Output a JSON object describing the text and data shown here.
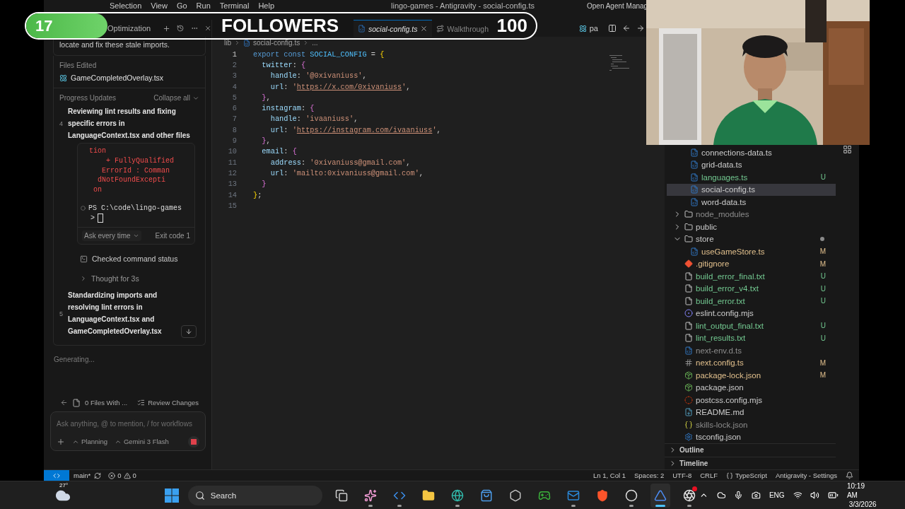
{
  "stream_banner": {
    "count": "17",
    "label": "FOLLOWERS",
    "goal": "100",
    "level": 0.16
  },
  "menu": [
    "Selection",
    "View",
    "Go",
    "Run",
    "Terminal",
    "Help"
  ],
  "window_title": "lingo-games - Antigravity - social-config.ts",
  "agent_manager_link": "Open Agent Manag",
  "agent": {
    "tab_title": "Optimization",
    "message_tail": "locate and fix these stale imports.",
    "files_edited": {
      "heading": "Files Edited",
      "files": [
        "GameCompletedOverlay.tsx"
      ]
    },
    "progress": {
      "heading": "Progress Updates",
      "collapse": "Collapse all",
      "steps": [
        {
          "number": "4",
          "title": "Reviewing lint results and fixing specific errors in LanguageContext.tsx and other files",
          "items": [
            {
              "kind": "terminal",
              "output": [
                "tion",
                "    + FullyQualified",
                "   ErrorId : Comman",
                "  dNotFoundExcepti",
                " on"
              ],
              "prompt": "PS C:\\code\\lingo-games",
              "continuation": ">",
              "approval": "Ask every time",
              "exit": "Exit code 1"
            },
            {
              "kind": "tool",
              "label": "Checked command status"
            },
            {
              "kind": "thought",
              "label": "Thought for 3s",
              "expanded": false
            }
          ]
        },
        {
          "number": "5",
          "title": "Standardizing imports and resolving lint errors in LanguageContext.tsx and GameCompletedOverlay.tsx"
        }
      ]
    },
    "status": "Generating...",
    "files_with": "0 Files With ...",
    "review": "Review Changes",
    "placeholder": "Ask anything, @ to mention, / for workflows",
    "mode": "Planning",
    "model": "Gemini 3 Flash"
  },
  "editor": {
    "tabs": [
      {
        "label": "social-config.ts",
        "kind": "ts",
        "selected": true,
        "preview": true
      },
      {
        "label": "Walkthrough",
        "kind": "steps",
        "selected": false,
        "preview": false
      }
    ],
    "side_tab": "pa",
    "breadcrumb": [
      "lib",
      "social-config.ts",
      "..."
    ],
    "lines": [
      {
        "number": "1",
        "active": true,
        "tokens": [
          {
            "t": "export const ",
            "kind": "keyword"
          },
          {
            "t": "SOCIAL_CONFIG",
            "kind": "constant"
          },
          {
            "t": " = ",
            "kind": "operator"
          },
          {
            "t": "{",
            "kind": "bracket1"
          }
        ]
      },
      {
        "number": "2",
        "active": false,
        "tokens": [
          {
            "t": "  twitter",
            "kind": "property"
          },
          {
            "t": ": ",
            "kind": "operator"
          },
          {
            "t": "{",
            "kind": "bracket2"
          }
        ]
      },
      {
        "number": "3",
        "active": false,
        "tokens": [
          {
            "t": "    handle",
            "kind": "property"
          },
          {
            "t": ": ",
            "kind": "operator"
          },
          {
            "t": "'@0xivaniuss'",
            "kind": "string"
          },
          {
            "t": ",",
            "kind": "operator"
          }
        ]
      },
      {
        "number": "4",
        "active": false,
        "tokens": [
          {
            "t": "    url",
            "kind": "property"
          },
          {
            "t": ": ",
            "kind": "operator"
          },
          {
            "t": "'",
            "kind": "string"
          },
          {
            "t": "https://x.com/0xivaniuss",
            "kind": "link"
          },
          {
            "t": "'",
            "kind": "string"
          },
          {
            "t": ",",
            "kind": "operator"
          }
        ]
      },
      {
        "number": "5",
        "active": false,
        "tokens": [
          {
            "t": "  }",
            "kind": "bracket2"
          },
          {
            "t": ",",
            "kind": "operator"
          }
        ]
      },
      {
        "number": "6",
        "active": false,
        "tokens": [
          {
            "t": "  instagram",
            "kind": "property"
          },
          {
            "t": ": ",
            "kind": "operator"
          },
          {
            "t": "{",
            "kind": "bracket2"
          }
        ]
      },
      {
        "number": "7",
        "active": false,
        "tokens": [
          {
            "t": "    handle",
            "kind": "property"
          },
          {
            "t": ": ",
            "kind": "operator"
          },
          {
            "t": "'ivaaniuss'",
            "kind": "string"
          },
          {
            "t": ",",
            "kind": "operator"
          }
        ]
      },
      {
        "number": "8",
        "active": false,
        "tokens": [
          {
            "t": "    url",
            "kind": "property"
          },
          {
            "t": ": ",
            "kind": "operator"
          },
          {
            "t": "'",
            "kind": "string"
          },
          {
            "t": "https://instagram.com/ivaaniuss",
            "kind": "link"
          },
          {
            "t": "'",
            "kind": "string"
          },
          {
            "t": ",",
            "kind": "operator"
          }
        ]
      },
      {
        "number": "9",
        "active": false,
        "tokens": [
          {
            "t": "  }",
            "kind": "bracket2"
          },
          {
            "t": ",",
            "kind": "operator"
          }
        ]
      },
      {
        "number": "10",
        "active": false,
        "tokens": [
          {
            "t": "  email",
            "kind": "property"
          },
          {
            "t": ": ",
            "kind": "operator"
          },
          {
            "t": "{",
            "kind": "bracket2"
          }
        ]
      },
      {
        "number": "11",
        "active": false,
        "tokens": [
          {
            "t": "    address",
            "kind": "property"
          },
          {
            "t": ": ",
            "kind": "operator"
          },
          {
            "t": "'0xivaniuss@gmail.com'",
            "kind": "string"
          },
          {
            "t": ",",
            "kind": "operator"
          }
        ]
      },
      {
        "number": "12",
        "active": false,
        "tokens": [
          {
            "t": "    url",
            "kind": "property"
          },
          {
            "t": ": ",
            "kind": "operator"
          },
          {
            "t": "'mailto:0xivaniuss@gmail.com'",
            "kind": "string"
          },
          {
            "t": ",",
            "kind": "operator"
          }
        ]
      },
      {
        "number": "13",
        "active": false,
        "tokens": [
          {
            "t": "  }",
            "kind": "bracket2"
          }
        ]
      },
      {
        "number": "14",
        "active": false,
        "tokens": [
          {
            "t": "}",
            "kind": "bracket1"
          },
          {
            "t": ";",
            "kind": "operator"
          }
        ]
      },
      {
        "number": "15",
        "active": false
      }
    ]
  },
  "explorer": {
    "open_folder_files": [
      {
        "name": "connections-data.ts",
        "kind": "ts",
        "color": "#cccccc",
        "selected": false
      },
      {
        "name": "grid-data.ts",
        "kind": "ts",
        "color": "#cccccc",
        "selected": false
      },
      {
        "name": "languages.ts",
        "kind": "ts",
        "color": "#73c991",
        "status": "U",
        "selected": false
      },
      {
        "name": "social-config.ts",
        "kind": "ts",
        "color": "#cccccc",
        "selected": true
      },
      {
        "name": "word-data.ts",
        "kind": "ts",
        "color": "#cccccc",
        "selected": false
      }
    ],
    "items": [
      {
        "name": "node_modules",
        "kind": "folder",
        "color": "#8c8c8c",
        "expanded": false,
        "selected": false
      },
      {
        "name": "public",
        "kind": "folder",
        "color": "#cccccc",
        "expanded": false,
        "selected": false
      },
      {
        "name": "store",
        "kind": "folder",
        "color": "#cccccc",
        "expanded": true,
        "changes_dot": true,
        "selected": false,
        "children": [
          {
            "name": "useGameStore.ts",
            "kind": "ts",
            "color": "#e2c08d",
            "status": "M",
            "selected": false
          }
        ]
      },
      {
        "name": ".gitignore",
        "kind": "git",
        "color": "#e2c08d",
        "status": "M",
        "selected": false
      },
      {
        "name": "build_error_final.txt",
        "kind": "text",
        "color": "#73c991",
        "status": "U",
        "selected": false
      },
      {
        "name": "build_error_v4.txt",
        "kind": "text",
        "color": "#73c991",
        "status": "U",
        "selected": false
      },
      {
        "name": "build_error.txt",
        "kind": "text",
        "color": "#73c991",
        "status": "U",
        "selected": false
      },
      {
        "name": "eslint.config.mjs",
        "kind": "eslint",
        "color": "#cccccc",
        "selected": false
      },
      {
        "name": "lint_output_final.txt",
        "kind": "text",
        "color": "#73c991",
        "status": "U",
        "selected": false
      },
      {
        "name": "lint_results.txt",
        "kind": "text",
        "color": "#73c991",
        "status": "U",
        "selected": false
      },
      {
        "name": "next-env.d.ts",
        "kind": "ts",
        "color": "#8c8c8c",
        "selected": false
      },
      {
        "name": "next.config.ts",
        "kind": "next",
        "color": "#e2c08d",
        "status": "M",
        "selected": false
      },
      {
        "name": "package-lock.json",
        "kind": "npm",
        "color": "#e2c08d",
        "status": "M",
        "selected": false
      },
      {
        "name": "package.json",
        "kind": "npm",
        "color": "#cccccc",
        "selected": false
      },
      {
        "name": "postcss.config.mjs",
        "kind": "postcss",
        "color": "#cccccc",
        "selected": false
      },
      {
        "name": "README.md",
        "kind": "markdown",
        "color": "#cccccc",
        "selected": false
      },
      {
        "name": "skills-lock.json",
        "kind": "json",
        "color": "#8c8c8c",
        "selected": false
      },
      {
        "name": "tsconfig.json",
        "kind": "tsconfig",
        "color": "#cccccc",
        "selected": false
      }
    ],
    "sections": [
      {
        "label": "Outline",
        "expanded": false
      },
      {
        "label": "Timeline",
        "expanded": false
      }
    ]
  },
  "status_bar": {
    "branch": "main*",
    "errors": "0",
    "warnings": "0",
    "right": [
      {
        "label": "Ln 1, Col 1",
        "kind": "plain"
      },
      {
        "label": "Spaces: 2",
        "kind": "plain"
      },
      {
        "label": "UTF-8",
        "kind": "plain"
      },
      {
        "label": "CRLF",
        "kind": "plain"
      },
      {
        "label": "TypeScript",
        "kind": "language"
      },
      {
        "label": "Antigravity - Settings",
        "kind": "plain"
      }
    ]
  },
  "taskbar": {
    "weather": "27°",
    "search": "Search",
    "apps": [
      {
        "kind": "taskview",
        "running": false,
        "selected": false
      },
      {
        "kind": "copilot",
        "running": true,
        "selected": false
      },
      {
        "kind": "code",
        "running": true,
        "selected": false
      },
      {
        "kind": "files",
        "running": false,
        "selected": false
      },
      {
        "kind": "edge",
        "running": true,
        "selected": false
      },
      {
        "kind": "store",
        "running": false,
        "selected": false
      },
      {
        "kind": "hexagon",
        "running": false,
        "selected": false
      },
      {
        "kind": "xbox",
        "running": false,
        "selected": false
      },
      {
        "kind": "mail",
        "running": true,
        "selected": false
      },
      {
        "kind": "brave",
        "running": false,
        "selected": false
      },
      {
        "kind": "circle",
        "running": true,
        "selected": false
      },
      {
        "kind": "antigravity",
        "running": true,
        "selected": true
      },
      {
        "kind": "obs",
        "running": true,
        "selected": false,
        "notification": true
      }
    ],
    "language": "ENG",
    "time": "10:19 AM",
    "date": "3/3/2026"
  }
}
